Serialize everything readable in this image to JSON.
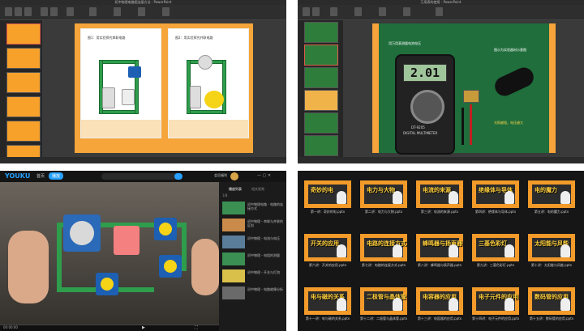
{
  "q1": {
    "window_title": "初中物理电路图连接方法 - PowerPoint",
    "slide_left_title": "图1：用实验探究串联电路",
    "slide_right_title": "图2：用实验探究并联电路",
    "colors": {
      "orange": "#f39b2c",
      "wire": "#2e9d4c"
    }
  },
  "q2": {
    "window_title": "万用表的使用 - PowerPoint",
    "reading": "2.01",
    "meter_model": "DT-9205",
    "meter_label": "DIGITAL MULTIMETER",
    "note_top": "用万用表测量电池电压",
    "note_right": "图示为实验器材示意图",
    "note_bottom": "光照越强，电压越大"
  },
  "q3": {
    "logo": "YOUKU",
    "nav_home": "首页",
    "nav_active": "播放",
    "search_placeholder": "",
    "upload_label": "会员福利",
    "side_tab_active": "播放列表",
    "side_tab_other": "相关视频",
    "side_count": "1/8",
    "playlist": [
      {
        "title": "初中物理电路 - 电路的连接方式",
        "date": "2021-07-12"
      },
      {
        "title": "初中物理 - 串联与并联的区别",
        "date": "2021-07-12"
      },
      {
        "title": "初中物理 - 电流与电压",
        "date": "2021-07-13"
      },
      {
        "title": "初中物理 - 电阻的测量",
        "date": "2021-07-13"
      },
      {
        "title": "初中物理 - 开关与灯泡",
        "date": "2021-07-14"
      },
      {
        "title": "初中物理 - 电路故障分析",
        "date": "2021-07-14"
      }
    ],
    "time": "00:00:00"
  },
  "q4": {
    "cards": [
      {
        "caption": "奇妙的电",
        "file": "第一讲：奇妙的电.pptx"
      },
      {
        "caption": "电力与大物",
        "file": "第二讲：电力与大物.pptx"
      },
      {
        "caption": "电流的来源",
        "file": "第三讲：电流的来源.pptx"
      },
      {
        "caption": "绝缘体与导体",
        "file": "第四讲：绝缘体与导体.pptx"
      },
      {
        "caption": "电的魔力",
        "file": "第五讲：电的魔力.pptx"
      },
      {
        "caption": "开关的应用",
        "file": "第六讲：开关的应用.pptx"
      },
      {
        "caption": "电路的连接方式",
        "file": "第七讲：电路的连接方式.pptx"
      },
      {
        "caption": "蜂鸣器与扬声器",
        "file": "第八讲：蜂鸣器与扬声器.pptx"
      },
      {
        "caption": "三基色彩灯",
        "file": "第九讲：三基色彩灯.pptx"
      },
      {
        "caption": "太阳能与风能",
        "file": "第十讲：太阳能与风能.pptx"
      },
      {
        "caption": "电与磁的关系",
        "file": "第十一讲：电与磁的关系.pptx"
      },
      {
        "caption": "二极管与晶体管",
        "file": "第十二讲：二极管与晶体管.pptx"
      },
      {
        "caption": "电容器的应用",
        "file": "第十三讲：电容器的应用.pptx"
      },
      {
        "caption": "电子元件的应用",
        "file": "第十四讲：电子元件的应用.pptx"
      },
      {
        "caption": "数码管的应用",
        "file": "第十五讲：数码管的应用.pptx"
      }
    ]
  }
}
